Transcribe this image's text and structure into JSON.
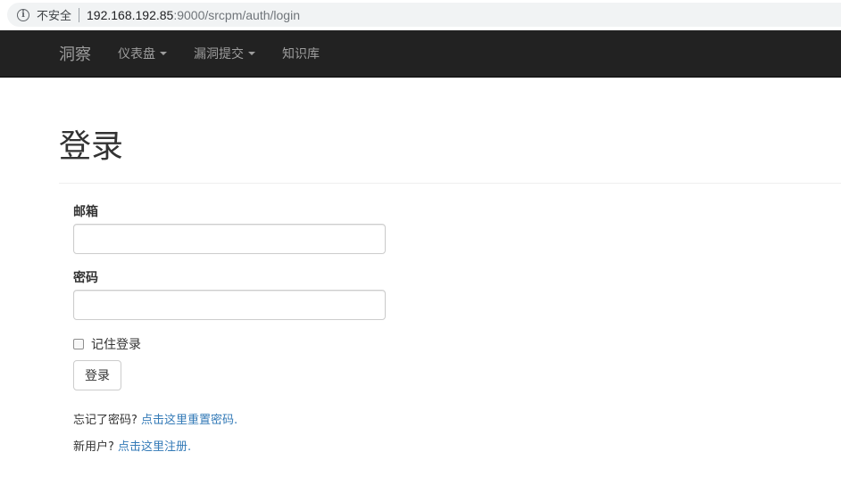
{
  "browser": {
    "security_label": "不安全",
    "url_host": "192.168.192.85",
    "url_rest": ":9000/srcpm/auth/login"
  },
  "navbar": {
    "brand": "洞察",
    "items": [
      {
        "label": "仪表盘",
        "dropdown": true
      },
      {
        "label": "漏洞提交",
        "dropdown": true
      },
      {
        "label": "知识库",
        "dropdown": false
      }
    ]
  },
  "page": {
    "title": "登录"
  },
  "form": {
    "email_label": "邮箱",
    "email_value": "",
    "password_label": "密码",
    "password_value": "",
    "remember_label": "记住登录",
    "remember_checked": false,
    "submit_label": "登录"
  },
  "help": {
    "forgot_text": "忘记了密码? ",
    "forgot_link": "点击这里重置密码.",
    "register_text": "新用户? ",
    "register_link": "点击这里注册."
  },
  "colors": {
    "navbar_bg": "#222222",
    "nav_text": "#9d9d9d",
    "link": "#337ab7"
  }
}
